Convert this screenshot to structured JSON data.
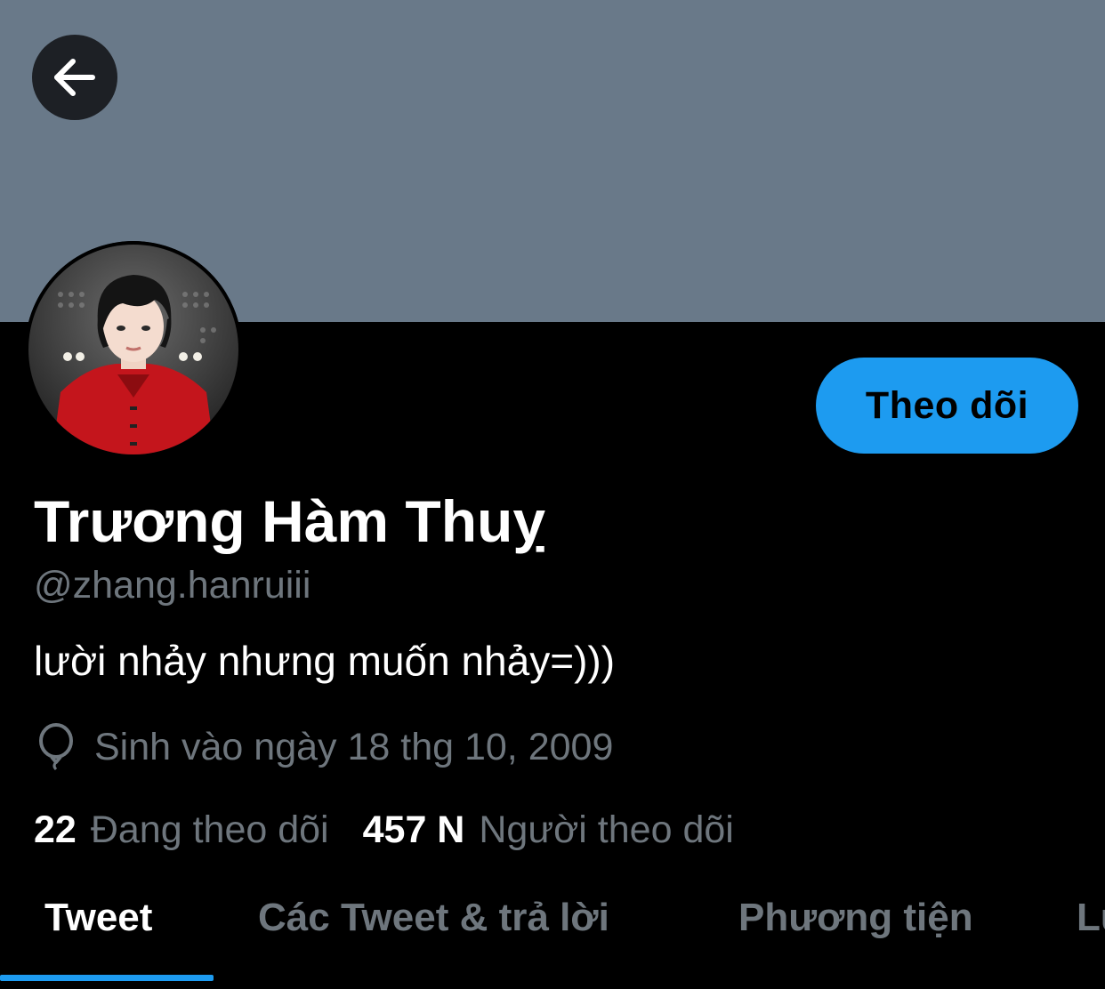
{
  "header": {
    "back_icon": "arrow-left-icon",
    "banner_color": "#697989"
  },
  "profile": {
    "display_name": "Trương Hàm Thuỵ",
    "handle": "@zhang.hanruiii",
    "bio": "lười nhảy nhưng muốn nhảy=)))",
    "birth_icon": "balloon-icon",
    "birth_text": "Sinh vào ngày 18 thg 10, 2009",
    "follow_label": "Theo dõi",
    "accent_color": "#1d9bf0"
  },
  "stats": {
    "following_count": "22",
    "following_label": "Đang theo dõi",
    "followers_count": "457 N",
    "followers_label": "Người theo dõi"
  },
  "tabs": [
    {
      "label": "Tweet",
      "active": true
    },
    {
      "label": "Các Tweet & trả lời",
      "active": false
    },
    {
      "label": "Phương tiện",
      "active": false
    },
    {
      "label": "Lư",
      "active": false
    }
  ]
}
